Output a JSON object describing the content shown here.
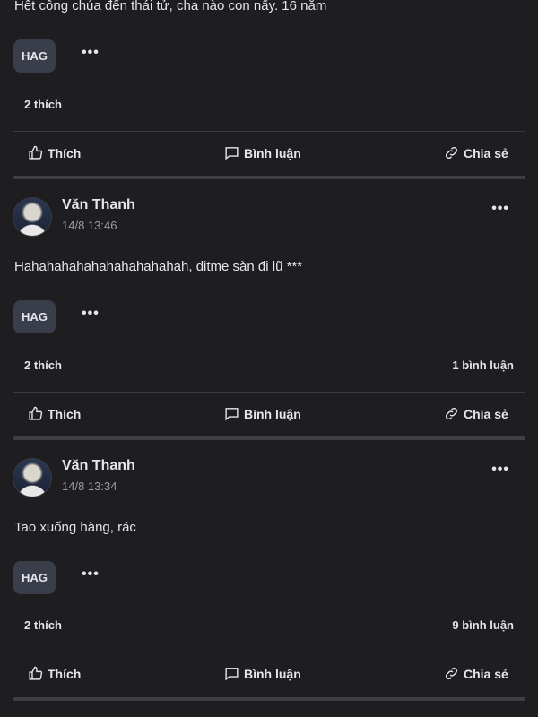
{
  "top_post": {
    "text": "Hết công chúa đến thái tử, cha nào con nấy. 16 năm",
    "tag": "HAG",
    "more": "•••",
    "likes": "2 thích"
  },
  "actions": {
    "like": "Thích",
    "comment": "Bình luận",
    "share": "Chia sẻ"
  },
  "posts": [
    {
      "author": "Văn Thanh",
      "time": "14/8 13:46",
      "text": "Hahahahahahahahahahahah, ditme sàn đi lũ ***",
      "tag": "HAG",
      "more": "•••",
      "likes": "2 thích",
      "comments": "1 bình luận"
    },
    {
      "author": "Văn Thanh",
      "time": "14/8 13:34",
      "text": "Tao xuống hàng, rác",
      "tag": "HAG",
      "more": "•••",
      "likes": "2 thích",
      "comments": "9 bình luận"
    }
  ],
  "icons": {
    "like": "thumbs-up-icon",
    "comment": "comment-bubble-icon",
    "share": "link-icon",
    "more": "more-dots-icon"
  }
}
